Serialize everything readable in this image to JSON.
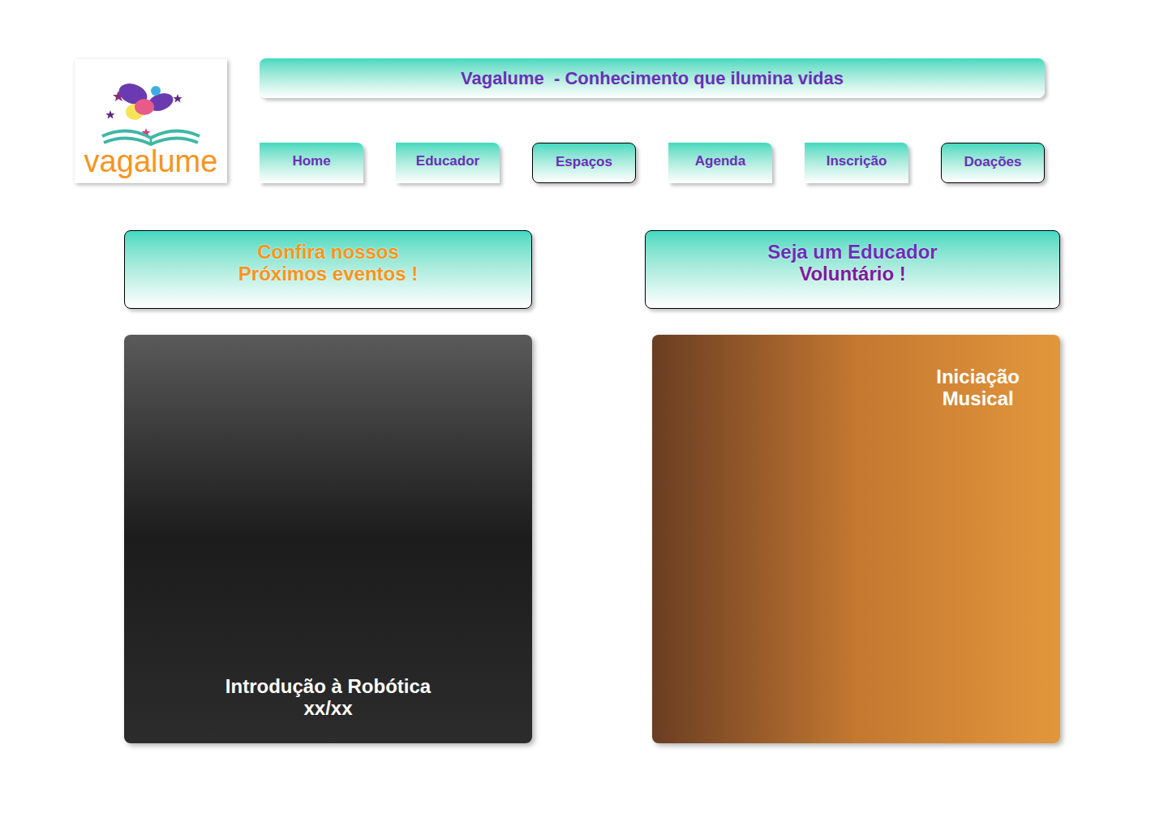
{
  "logo": {
    "text": "vagalume"
  },
  "header": {
    "title": "Vagalume  - Conhecimento que ilumina vidas"
  },
  "nav": [
    {
      "label": "Home",
      "outlined": false
    },
    {
      "label": "Educador",
      "outlined": false
    },
    {
      "label": "Espaços",
      "outlined": true
    },
    {
      "label": "Agenda",
      "outlined": false
    },
    {
      "label": "Inscrição",
      "outlined": false
    },
    {
      "label": "Doações",
      "outlined": true
    }
  ],
  "panels": [
    {
      "lines": [
        {
          "text": "Confira nossos",
          "color": "#f7941d"
        },
        {
          "text": "Próximos eventos !",
          "color": "#f7941d"
        }
      ]
    },
    {
      "lines": [
        {
          "text": "Seja um Educador",
          "color": "#6a2fb8"
        },
        {
          "text": "Voluntário !",
          "color": "#7d1a9e"
        }
      ]
    }
  ],
  "events": [
    {
      "lines": [
        "Introdução à Robótica",
        "xx/xx"
      ],
      "placement": "bottom"
    },
    {
      "lines": [
        "Iniciação",
        "Musical"
      ],
      "placement": "top-right"
    }
  ]
}
